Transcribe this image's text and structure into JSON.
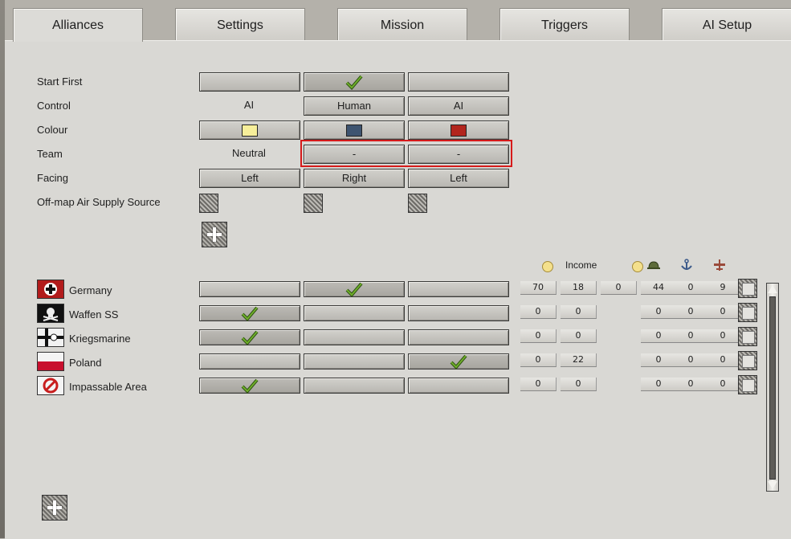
{
  "tabs": [
    {
      "label": "Alliances",
      "active": true
    },
    {
      "label": "Settings"
    },
    {
      "label": "Mission"
    },
    {
      "label": "Triggers"
    },
    {
      "label": "AI Setup"
    }
  ],
  "rows": {
    "start_first": "Start First",
    "control": "Control",
    "colour": "Colour",
    "team": "Team",
    "facing": "Facing",
    "air_supply": "Off-map Air Supply Source"
  },
  "sides": [
    {
      "control": "AI",
      "colour": "#f7ef9a",
      "team": "Neutral",
      "facing": "Left",
      "start_first": false
    },
    {
      "control": "Human",
      "colour": "#3e5470",
      "team": "-",
      "facing": "Right",
      "start_first": true
    },
    {
      "control": "AI",
      "colour": "#b2261e",
      "team": "-",
      "facing": "Left",
      "start_first": false
    }
  ],
  "resources_header": {
    "income": "Income"
  },
  "factions": [
    {
      "name": "Germany",
      "side": 2,
      "values": [
        "70",
        "18",
        "0",
        "44",
        "0",
        "9"
      ]
    },
    {
      "name": "Waffen SS",
      "side": 1,
      "values": [
        "0",
        "0",
        "",
        "0",
        "0",
        "0"
      ]
    },
    {
      "name": "Kriegsmarine",
      "side": 1,
      "values": [
        "0",
        "0",
        "",
        "0",
        "0",
        "0"
      ]
    },
    {
      "name": "Poland",
      "side": 3,
      "values": [
        "0",
        "22",
        "",
        "0",
        "0",
        "0"
      ]
    },
    {
      "name": "Impassable Area",
      "side": 1,
      "values": [
        "0",
        "0",
        "",
        "0",
        "0",
        "0"
      ]
    }
  ],
  "icons": {
    "check": "checkmark-icon",
    "add": "plus-icon",
    "coin": "coin-icon",
    "helmet": "helmet-icon",
    "anchor": "anchor-icon",
    "plane": "plane-icon"
  },
  "colors": {
    "highlight": "#d61a1a",
    "check_green": "#4f8a1e"
  }
}
